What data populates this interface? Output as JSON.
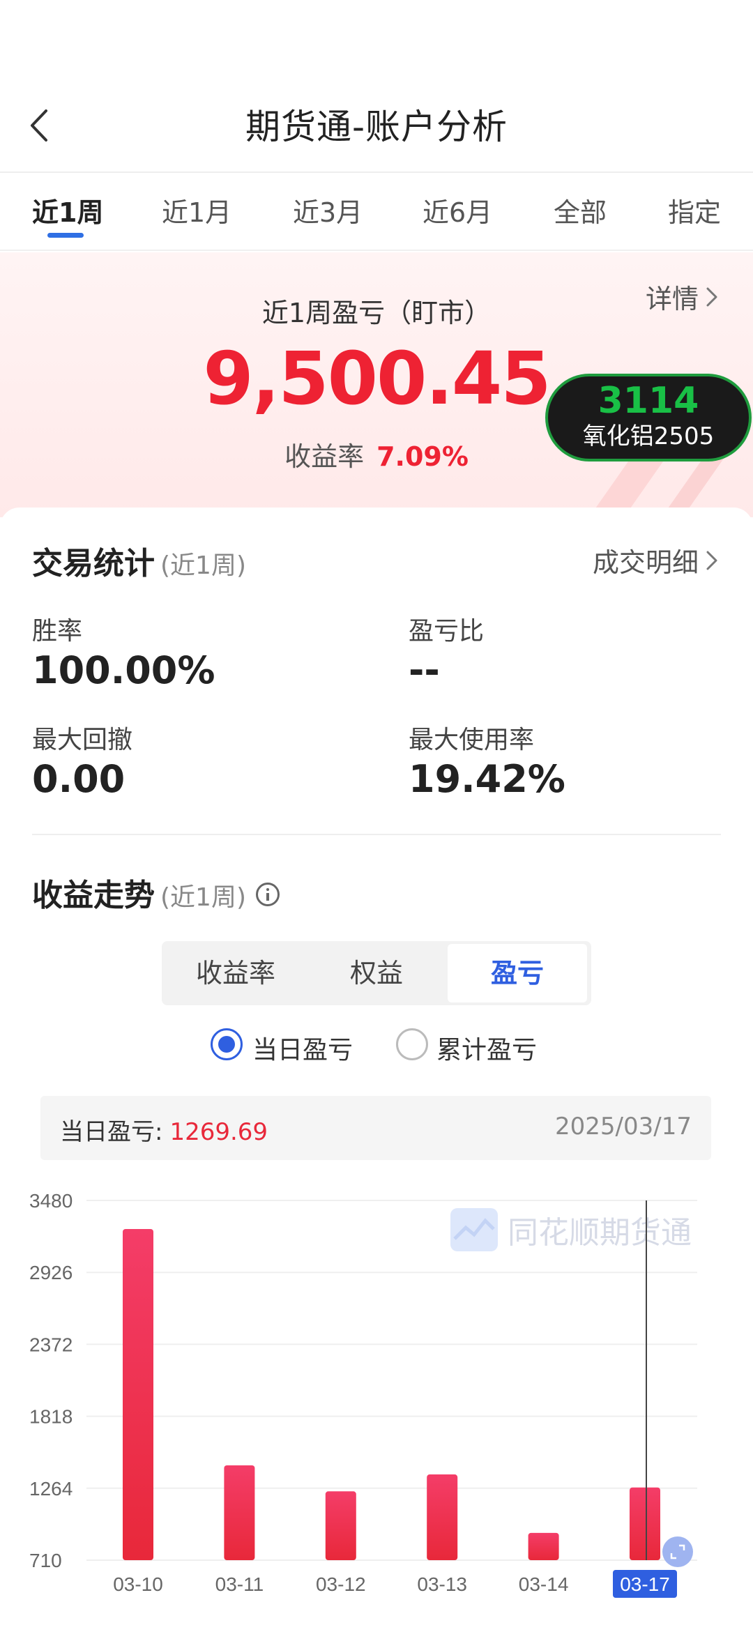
{
  "header": {
    "title": "期货通-账户分析"
  },
  "tabs": [
    {
      "label": "近1周",
      "active": true
    },
    {
      "label": "近1月",
      "active": false
    },
    {
      "label": "近3月",
      "active": false
    },
    {
      "label": "近6月",
      "active": false
    },
    {
      "label": "全部",
      "active": false
    },
    {
      "label": "指定",
      "active": false
    }
  ],
  "hero": {
    "label": "近1周盈亏（盯市）",
    "detail_link": "详情",
    "value": "9,500.45",
    "rate_label": "收益率",
    "rate_value": "7.09%"
  },
  "floating_badge": {
    "price": "3114",
    "name": "氧化铝2505"
  },
  "trade_stats": {
    "title": "交易统计",
    "period": "(近1周)",
    "link": "成交明细",
    "win_rate_label": "胜率",
    "win_rate": "100.00%",
    "pl_ratio_label": "盈亏比",
    "pl_ratio": "--",
    "max_drawdown_label": "最大回撤",
    "max_drawdown": "0.00",
    "max_usage_label": "最大使用率",
    "max_usage": "19.42%"
  },
  "trend": {
    "title": "收益走势",
    "period": "(近1周)",
    "segments": [
      "收益率",
      "权益",
      "盈亏"
    ],
    "active_segment": 2,
    "radio_daily": "当日盈亏",
    "radio_cumulative": "累计盈亏",
    "tip_label": "当日盈亏:",
    "tip_value": "1269.69",
    "tip_date": "2025/03/17",
    "watermark": "同花顺期货通"
  },
  "colors": {
    "accent": "#2f5fe0",
    "profit": "#ee2233",
    "bar": "#f0345a",
    "badge_green": "#19c046"
  },
  "chart_data": {
    "type": "bar",
    "categories": [
      "03-10",
      "03-11",
      "03-12",
      "03-13",
      "03-14",
      "03-17"
    ],
    "values": [
      3260,
      1440,
      1240,
      1370,
      920,
      1269.69
    ],
    "ylim": [
      710,
      3480
    ],
    "yticks": [
      "3480",
      "2926",
      "2372",
      "1818",
      "1264",
      "710"
    ],
    "selected_index": 5,
    "grid": true
  }
}
